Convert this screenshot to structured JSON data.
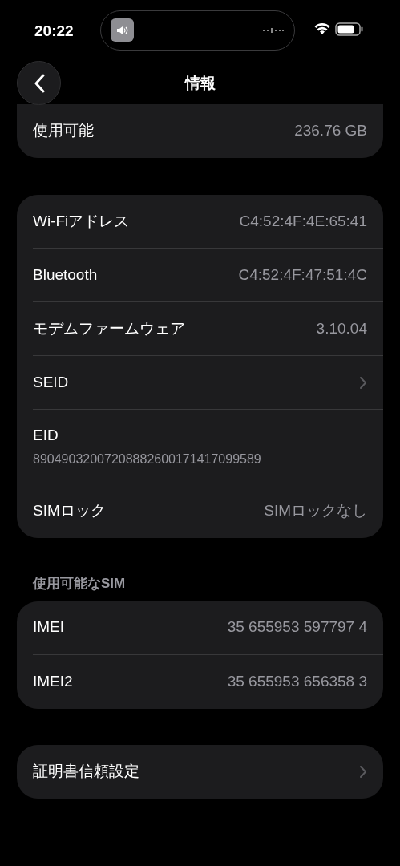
{
  "status_bar": {
    "time": "20:22"
  },
  "nav": {
    "title": "情報"
  },
  "groups": [
    {
      "rows": [
        {
          "kind": "value",
          "label": "使用可能",
          "value": "236.76 GB"
        }
      ]
    },
    {
      "rows": [
        {
          "kind": "value",
          "label": "Wi-Fiアドレス",
          "value": "C4:52:4F:4E:65:41"
        },
        {
          "kind": "value",
          "label": "Bluetooth",
          "value": "C4:52:4F:47:51:4C"
        },
        {
          "kind": "value",
          "label": "モデムファームウェア",
          "value": "3.10.04"
        },
        {
          "kind": "chevron",
          "label": "SEID"
        },
        {
          "kind": "stacked",
          "label": "EID",
          "value": "89049032007208882600171417099589"
        },
        {
          "kind": "value",
          "label": "SIMロック",
          "value": "SIMロックなし"
        }
      ]
    },
    {
      "header": "使用可能なSIM",
      "rows": [
        {
          "kind": "value",
          "label": "IMEI",
          "value": "35 655953 597797 4"
        },
        {
          "kind": "value",
          "label": "IMEI2",
          "value": "35 655953 656358 3"
        }
      ]
    },
    {
      "rows": [
        {
          "kind": "chevron",
          "label": "証明書信頼設定"
        }
      ]
    }
  ]
}
